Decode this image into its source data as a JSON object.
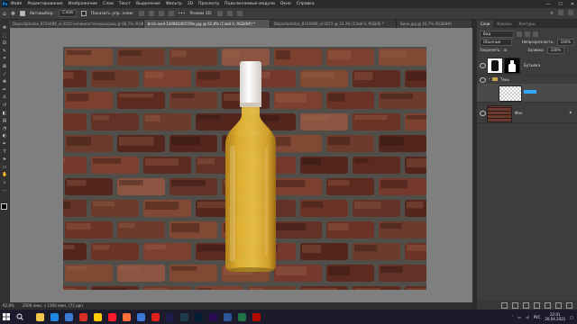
{
  "app": {
    "name": "Photoshop",
    "logo_text": "Ps"
  },
  "menubar": {
    "items": [
      "Файл",
      "Редактирование",
      "Изображение",
      "Слои",
      "Текст",
      "Выделение",
      "Фильтр",
      "3D",
      "Просмотр",
      "Подключаемые модули",
      "Окно",
      "Справка"
    ],
    "window_controls": {
      "minimize": "—",
      "maximize": "☐",
      "close": "✕"
    }
  },
  "options_bar": {
    "autoselect_label": "Автовыбор:",
    "autoselect_value": "Слой",
    "show_transform_label": "Показать упр. элем.",
    "mode_3d_label": "Режим 3D:"
  },
  "tabs": [
    {
      "label": "Depositphotos_8314489_xl-2015 копиинастенкувысред @ 66,7% (RGB/8) *",
      "active": false
    },
    {
      "label": "brick-wall-1446834015f9e.jpg @ 62,8% (Слой 0, RGB/8#) *",
      "active": true
    },
    {
      "label": "Depositphotos_8314489_xl-2015 @ 33,3% (Слой 0, RGB/8) *",
      "active": false
    },
    {
      "label": "Вино.jpg @ 16,7% (RGB/8#)",
      "active": false
    }
  ],
  "status": {
    "zoom": "62,8%",
    "info": "2000 пикс. x 1300 пикс. (72 ppi)"
  },
  "panels": {
    "tabs": [
      "Слои",
      "Каналы",
      "Контуры"
    ],
    "filter_label": "Вид",
    "blend_mode": "Обычные",
    "opacity_label": "Непрозрачность:",
    "opacity_value": "100%",
    "lock_label": "Закрепить:",
    "fill_label": "Заливка:",
    "fill_value": "100%",
    "layers": [
      {
        "name": "Бутылка",
        "visible": true
      },
      {
        "name": "Тень",
        "visible": true,
        "group": true
      },
      {
        "name": "",
        "visible": false,
        "selected": true
      },
      {
        "name": "Фон",
        "visible": true,
        "locked": true
      }
    ]
  },
  "taskbar": {
    "apps": [
      {
        "icon": "file-explorer-icon",
        "color": "#f2c84b"
      },
      {
        "icon": "edge-icon",
        "color": "#1e88e5"
      },
      {
        "icon": "store-icon",
        "color": "#3a7bd5"
      },
      {
        "icon": "chrome-icon",
        "color": "#d93025"
      },
      {
        "icon": "yandex-icon",
        "color": "#ffcc00"
      },
      {
        "icon": "opera-icon",
        "color": "#ff1b2d"
      },
      {
        "icon": "firefox-icon",
        "color": "#ff7139"
      },
      {
        "icon": "photos-icon",
        "color": "#3c78d8"
      },
      {
        "icon": "acrobat-icon",
        "color": "#e0201b"
      },
      {
        "icon": "after-effects-icon",
        "color": "#1c1c4d"
      },
      {
        "icon": "media-encoder-icon",
        "color": "#1c3b4d"
      },
      {
        "icon": "photoshop-icon",
        "color": "#001e36"
      },
      {
        "icon": "premiere-icon",
        "color": "#2a0d54"
      },
      {
        "icon": "word-icon",
        "color": "#2b579a"
      },
      {
        "icon": "excel-icon",
        "color": "#217346"
      },
      {
        "icon": "acrobat-reader-icon",
        "color": "#b30b00"
      }
    ],
    "tray": {
      "language": "РУС",
      "time": "22:01",
      "date": "20.04.2021"
    }
  },
  "colors": {
    "accent": "#31a8ff",
    "canvas": "#7f7f7f",
    "panel": "#3d3d3d",
    "wine": "#e8b830",
    "cap": "#f3f0ec"
  }
}
